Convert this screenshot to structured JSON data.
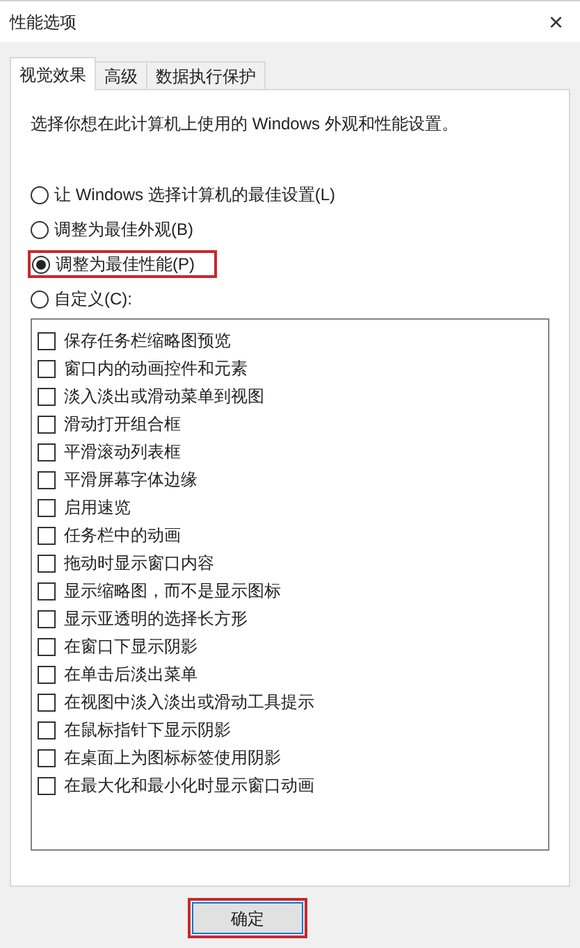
{
  "window": {
    "title": "性能选项",
    "close": "×"
  },
  "tabs": [
    {
      "label": "视觉效果",
      "selected": true
    },
    {
      "label": "高级",
      "selected": false
    },
    {
      "label": "数据执行保护",
      "selected": false
    }
  ],
  "description": "选择你想在此计算机上使用的 Windows 外观和性能设置。",
  "options": [
    {
      "label": "让 Windows 选择计算机的最佳设置(L)",
      "selected": false,
      "highlighted": false
    },
    {
      "label": "调整为最佳外观(B)",
      "selected": false,
      "highlighted": false
    },
    {
      "label": "调整为最佳性能(P)",
      "selected": true,
      "highlighted": true
    },
    {
      "label": "自定义(C):",
      "selected": false,
      "highlighted": false
    }
  ],
  "effects": [
    {
      "label": "保存任务栏缩略图预览",
      "checked": false
    },
    {
      "label": "窗口内的动画控件和元素",
      "checked": false
    },
    {
      "label": "淡入淡出或滑动菜单到视图",
      "checked": false
    },
    {
      "label": "滑动打开组合框",
      "checked": false
    },
    {
      "label": "平滑滚动列表框",
      "checked": false
    },
    {
      "label": "平滑屏幕字体边缘",
      "checked": false
    },
    {
      "label": "启用速览",
      "checked": false
    },
    {
      "label": "任务栏中的动画",
      "checked": false
    },
    {
      "label": "拖动时显示窗口内容",
      "checked": false
    },
    {
      "label": "显示缩略图，而不是显示图标",
      "checked": false
    },
    {
      "label": "显示亚透明的选择长方形",
      "checked": false
    },
    {
      "label": "在窗口下显示阴影",
      "checked": false
    },
    {
      "label": "在单击后淡出菜单",
      "checked": false
    },
    {
      "label": "在视图中淡入淡出或滑动工具提示",
      "checked": false
    },
    {
      "label": "在鼠标指针下显示阴影",
      "checked": false
    },
    {
      "label": "在桌面上为图标标签使用阴影",
      "checked": false
    },
    {
      "label": "在最大化和最小化时显示窗口动画",
      "checked": false
    }
  ],
  "buttons": [
    {
      "label": "确定",
      "highlighted": true
    }
  ]
}
